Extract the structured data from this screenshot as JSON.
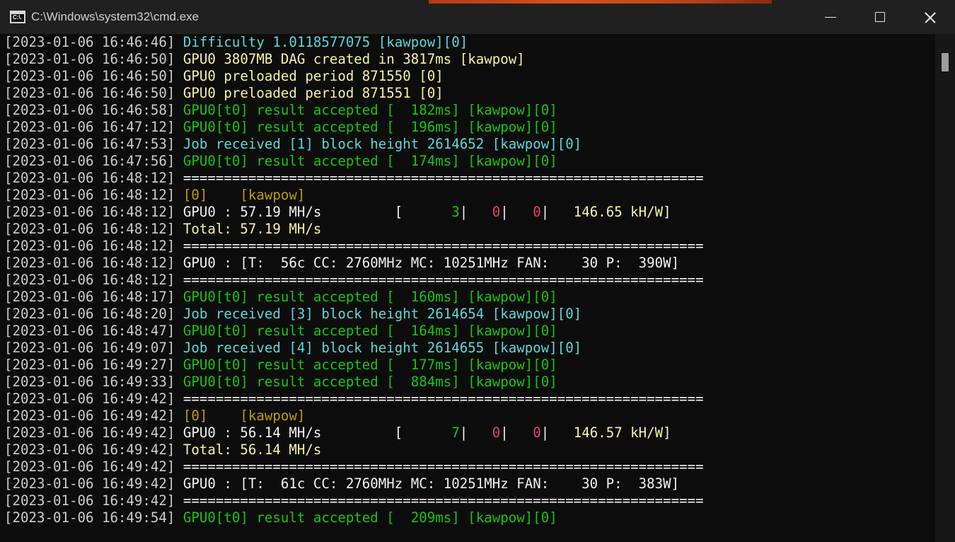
{
  "window": {
    "title": "C:\\Windows\\system32\\cmd.exe",
    "icon_text": "C:\\.",
    "icon": "cmd-icon",
    "controls": [
      "minimize-icon",
      "maximize-icon",
      "close-icon"
    ]
  },
  "colors": {
    "background": "#0c0c0c",
    "timestamp": "#cccccc",
    "cyan": "#61d6d6",
    "yellow": "#f9f1a5",
    "green": "#16c60c",
    "gold": "#c19c00",
    "white": "#f2f2f2",
    "red": "#e74856"
  },
  "console": {
    "lines": [
      {
        "ts": "[2023-01-06 16:46:46]",
        "segs": [
          {
            "t": "Difficulty 1.0118577075 [kawpow][0]",
            "c": "cyan"
          }
        ]
      },
      {
        "ts": "[2023-01-06 16:46:50]",
        "segs": [
          {
            "t": "GPU0 3807MB DAG created in 3817ms [kawpow]",
            "c": "yellow"
          }
        ]
      },
      {
        "ts": "[2023-01-06 16:46:50]",
        "segs": [
          {
            "t": "GPU0 preloaded period 871550 [0]",
            "c": "yellow"
          }
        ]
      },
      {
        "ts": "[2023-01-06 16:46:50]",
        "segs": [
          {
            "t": "GPU0 preloaded period 871551 [0]",
            "c": "yellow"
          }
        ]
      },
      {
        "ts": "[2023-01-06 16:46:58]",
        "segs": [
          {
            "t": "GPU0[t0] result accepted [  182ms] [kawpow][0]",
            "c": "green"
          }
        ]
      },
      {
        "ts": "[2023-01-06 16:47:12]",
        "segs": [
          {
            "t": "GPU0[t0] result accepted [  196ms] [kawpow][0]",
            "c": "green"
          }
        ]
      },
      {
        "ts": "[2023-01-06 16:47:53]",
        "segs": [
          {
            "t": "Job received [1] block height 2614652 [kawpow][0]",
            "c": "cyan"
          }
        ]
      },
      {
        "ts": "[2023-01-06 16:47:56]",
        "segs": [
          {
            "t": "GPU0[t0] result accepted [  174ms] [kawpow][0]",
            "c": "green"
          }
        ]
      },
      {
        "ts": "[2023-01-06 16:48:12]",
        "segs": [
          {
            "t": "================================================================",
            "c": "white"
          }
        ]
      },
      {
        "ts": "[2023-01-06 16:48:12]",
        "segs": [
          {
            "t": "[0]    [kawpow]",
            "c": "gold"
          }
        ]
      },
      {
        "ts": "[2023-01-06 16:48:12]",
        "segs": [
          {
            "t": "GPU0 : 57.19 MH/s         [      ",
            "c": "white"
          },
          {
            "t": "3",
            "c": "green"
          },
          {
            "t": "|   ",
            "c": "white"
          },
          {
            "t": "0",
            "c": "red"
          },
          {
            "t": "|   ",
            "c": "white"
          },
          {
            "t": "0",
            "c": "red"
          },
          {
            "t": "|   ",
            "c": "white"
          },
          {
            "t": "146.65 kH/W",
            "c": "yellow"
          },
          {
            "t": "]",
            "c": "white"
          }
        ]
      },
      {
        "ts": "[2023-01-06 16:48:12]",
        "segs": [
          {
            "t": "Total: 57.19 MH/s",
            "c": "yellow"
          }
        ]
      },
      {
        "ts": "[2023-01-06 16:48:12]",
        "segs": [
          {
            "t": "================================================================",
            "c": "white"
          }
        ]
      },
      {
        "ts": "[2023-01-06 16:48:12]",
        "segs": [
          {
            "t": "GPU0 : [T:  56c CC: 2760MHz MC: 10251MHz FAN:    30 P:  390W]",
            "c": "white"
          }
        ]
      },
      {
        "ts": "[2023-01-06 16:48:12]",
        "segs": [
          {
            "t": "================================================================",
            "c": "white"
          }
        ]
      },
      {
        "ts": "[2023-01-06 16:48:17]",
        "segs": [
          {
            "t": "GPU0[t0] result accepted [  160ms] [kawpow][0]",
            "c": "green"
          }
        ]
      },
      {
        "ts": "[2023-01-06 16:48:20]",
        "segs": [
          {
            "t": "Job received [3] block height 2614654 [kawpow][0]",
            "c": "cyan"
          }
        ]
      },
      {
        "ts": "[2023-01-06 16:48:47]",
        "segs": [
          {
            "t": "GPU0[t0] result accepted [  164ms] [kawpow][0]",
            "c": "green"
          }
        ]
      },
      {
        "ts": "[2023-01-06 16:49:07]",
        "segs": [
          {
            "t": "Job received [4] block height 2614655 [kawpow][0]",
            "c": "cyan"
          }
        ]
      },
      {
        "ts": "[2023-01-06 16:49:27]",
        "segs": [
          {
            "t": "GPU0[t0] result accepted [  177ms] [kawpow][0]",
            "c": "green"
          }
        ]
      },
      {
        "ts": "[2023-01-06 16:49:33]",
        "segs": [
          {
            "t": "GPU0[t0] result accepted [  884ms] [kawpow][0]",
            "c": "green"
          }
        ]
      },
      {
        "ts": "[2023-01-06 16:49:42]",
        "segs": [
          {
            "t": "================================================================",
            "c": "white"
          }
        ]
      },
      {
        "ts": "[2023-01-06 16:49:42]",
        "segs": [
          {
            "t": "[0]    [kawpow]",
            "c": "gold"
          }
        ]
      },
      {
        "ts": "[2023-01-06 16:49:42]",
        "segs": [
          {
            "t": "GPU0 : 56.14 MH/s         [      ",
            "c": "white"
          },
          {
            "t": "7",
            "c": "green"
          },
          {
            "t": "|   ",
            "c": "white"
          },
          {
            "t": "0",
            "c": "red"
          },
          {
            "t": "|   ",
            "c": "white"
          },
          {
            "t": "0",
            "c": "red"
          },
          {
            "t": "|   ",
            "c": "white"
          },
          {
            "t": "146.57 kH/W",
            "c": "yellow"
          },
          {
            "t": "]",
            "c": "white"
          }
        ]
      },
      {
        "ts": "[2023-01-06 16:49:42]",
        "segs": [
          {
            "t": "Total: 56.14 MH/s",
            "c": "yellow"
          }
        ]
      },
      {
        "ts": "[2023-01-06 16:49:42]",
        "segs": [
          {
            "t": "================================================================",
            "c": "white"
          }
        ]
      },
      {
        "ts": "[2023-01-06 16:49:42]",
        "segs": [
          {
            "t": "GPU0 : [T:  61c CC: 2760MHz MC: 10251MHz FAN:    30 P:  383W]",
            "c": "white"
          }
        ]
      },
      {
        "ts": "[2023-01-06 16:49:42]",
        "segs": [
          {
            "t": "================================================================",
            "c": "white"
          }
        ]
      },
      {
        "ts": "[2023-01-06 16:49:54]",
        "segs": [
          {
            "t": "GPU0[t0] result accepted [  209ms] [kawpow][0]",
            "c": "green"
          }
        ]
      }
    ]
  }
}
